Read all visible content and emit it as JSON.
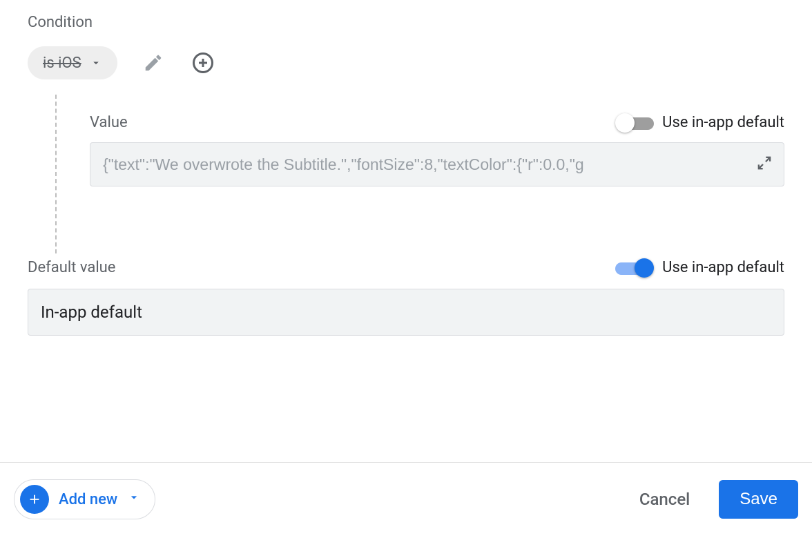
{
  "labels": {
    "condition": "Condition",
    "value": "Value",
    "use_in_app_default": "Use in-app default",
    "default_value": "Default value"
  },
  "condition_chip": {
    "label": "is iOS"
  },
  "value_field": {
    "text": "{\"text\":\"We overwrote the Subtitle.\",\"fontSize\":8,\"textColor\":{\"r\":0.0,\"g",
    "use_in_app_default": false
  },
  "default_field": {
    "text": "In-app default",
    "use_in_app_default": true
  },
  "footer": {
    "add_new": "Add new",
    "cancel": "Cancel",
    "save": "Save"
  }
}
